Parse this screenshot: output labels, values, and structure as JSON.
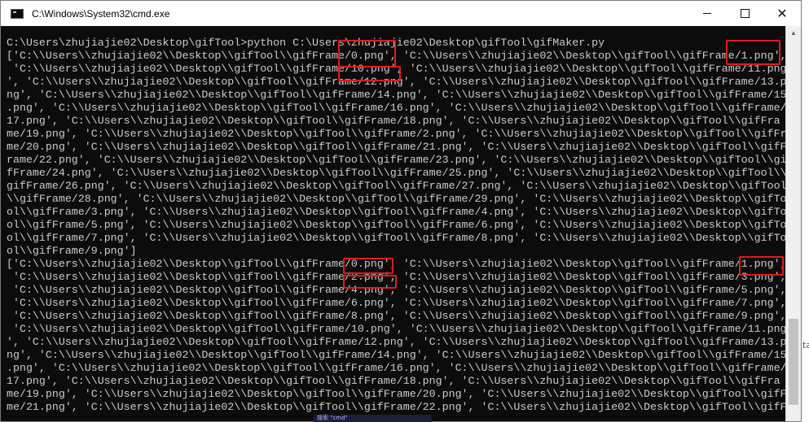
{
  "window": {
    "title": "C:\\Windows\\System32\\cmd.exe",
    "icon": "cmd-icon"
  },
  "console": {
    "lines": [
      "C:\\Users\\zhujiajie02\\Desktop\\gifTool>python C:\\Users\\zhujiajie02\\Desktop\\gifTool\\gifMaker.py",
      "['C:\\\\Users\\\\zhujiajie02\\\\Desktop\\\\gifTool\\\\gifFrame/0.png', 'C:\\\\Users\\\\zhujiajie02\\\\Desktop\\\\gifTool\\\\gifFrame/1.png',",
      " 'C:\\\\Users\\\\zhujiajie02\\\\Desktop\\\\gifTool\\\\gifFrame/10.png', 'C:\\\\Users\\\\zhujiajie02\\\\Desktop\\\\gifTool\\\\gifFrame/11.png",
      "', 'C:\\\\Users\\\\zhujiajie02\\\\Desktop\\\\gifTool\\\\gifFrame/12.png', 'C:\\\\Users\\\\zhujiajie02\\\\Desktop\\\\gifTool\\\\gifFrame/13.p",
      "ng', 'C:\\\\Users\\\\zhujiajie02\\\\Desktop\\\\gifTool\\\\gifFrame/14.png', 'C:\\\\Users\\\\zhujiajie02\\\\Desktop\\\\gifTool\\\\gifFrame/15",
      ".png', 'C:\\\\Users\\\\zhujiajie02\\\\Desktop\\\\gifTool\\\\gifFrame/16.png', 'C:\\\\Users\\\\zhujiajie02\\\\Desktop\\\\gifTool\\\\gifFrame/",
      "17.png', 'C:\\\\Users\\\\zhujiajie02\\\\Desktop\\\\gifTool\\\\gifFrame/18.png', 'C:\\\\Users\\\\zhujiajie02\\\\Desktop\\\\gifTool\\\\gifFra",
      "me/19.png', 'C:\\\\Users\\\\zhujiajie02\\\\Desktop\\\\gifTool\\\\gifFrame/2.png', 'C:\\\\Users\\\\zhujiajie02\\\\Desktop\\\\gifTool\\\\gifFra",
      "me/20.png', 'C:\\\\Users\\\\zhujiajie02\\\\Desktop\\\\gifTool\\\\gifFrame/21.png', 'C:\\\\Users\\\\zhujiajie02\\\\Desktop\\\\gifTool\\\\gifF",
      "rame/22.png', 'C:\\\\Users\\\\zhujiajie02\\\\Desktop\\\\gifTool\\\\gifFrame/23.png', 'C:\\\\Users\\\\zhujiajie02\\\\Desktop\\\\gifTool\\\\gi",
      "fFrame/24.png', 'C:\\\\Users\\\\zhujiajie02\\\\Desktop\\\\gifTool\\\\gifFrame/25.png', 'C:\\\\Users\\\\zhujiajie02\\\\Desktop\\\\gifTool\\\\",
      "gifFrame/26.png', 'C:\\\\Users\\\\zhujiajie02\\\\Desktop\\\\gifTool\\\\gifFrame/27.png', 'C:\\\\Users\\\\zhujiajie02\\\\Desktop\\\\gifTool",
      "\\\\gifFrame/28.png', 'C:\\\\Users\\\\zhujiajie02\\\\Desktop\\\\gifTool\\\\gifFrame/29.png', 'C:\\\\Users\\\\zhujiajie02\\\\Desktop\\\\gifTo",
      "ol\\\\gifFrame/3.png', 'C:\\\\Users\\\\zhujiajie02\\\\Desktop\\\\gifTool\\\\gifFrame/4.png', 'C:\\\\Users\\\\zhujiajie02\\\\Desktop\\\\gifTo",
      "ol\\\\gifFrame/5.png', 'C:\\\\Users\\\\zhujiajie02\\\\Desktop\\\\gifTool\\\\gifFrame/6.png', 'C:\\\\Users\\\\zhujiajie02\\\\Desktop\\\\gifTo",
      "ol\\\\gifFrame/7.png', 'C:\\\\Users\\\\zhujiajie02\\\\Desktop\\\\gifTool\\\\gifFrame/8.png', 'C:\\\\Users\\\\zhujiajie02\\\\Desktop\\\\gifTo",
      "ol\\\\gifFrame/9.png']",
      "['C:\\\\Users\\\\zhujiajie02\\\\Desktop\\\\gifTool\\\\gifFrame/0.png', 'C:\\\\Users\\\\zhujiajie02\\\\Desktop\\\\gifTool\\\\gifFrame/1.png',",
      " 'C:\\\\Users\\\\zhujiajie02\\\\Desktop\\\\gifTool\\\\gifFrame/2.png', 'C:\\\\Users\\\\zhujiajie02\\\\Desktop\\\\gifTool\\\\gifFrame/3.png',",
      " 'C:\\\\Users\\\\zhujiajie02\\\\Desktop\\\\gifTool\\\\gifFrame/4.png', 'C:\\\\Users\\\\zhujiajie02\\\\Desktop\\\\gifTool\\\\gifFrame/5.png',",
      " 'C:\\\\Users\\\\zhujiajie02\\\\Desktop\\\\gifTool\\\\gifFrame/6.png', 'C:\\\\Users\\\\zhujiajie02\\\\Desktop\\\\gifTool\\\\gifFrame/7.png',",
      " 'C:\\\\Users\\\\zhujiajie02\\\\Desktop\\\\gifTool\\\\gifFrame/8.png', 'C:\\\\Users\\\\zhujiajie02\\\\Desktop\\\\gifTool\\\\gifFrame/9.png',",
      " 'C:\\\\Users\\\\zhujiajie02\\\\Desktop\\\\gifTool\\\\gifFrame/10.png', 'C:\\\\Users\\\\zhujiajie02\\\\Desktop\\\\gifTool\\\\gifFrame/11.png",
      "', 'C:\\\\Users\\\\zhujiajie02\\\\Desktop\\\\gifTool\\\\gifFrame/12.png', 'C:\\\\Users\\\\zhujiajie02\\\\Desktop\\\\gifTool\\\\gifFrame/13.p",
      "ng', 'C:\\\\Users\\\\zhujiajie02\\\\Desktop\\\\gifTool\\\\gifFrame/14.png', 'C:\\\\Users\\\\zhujiajie02\\\\Desktop\\\\gifTool\\\\gifFrame/15",
      ".png', 'C:\\\\Users\\\\zhujiajie02\\\\Desktop\\\\gifTool\\\\gifFrame/16.png', 'C:\\\\Users\\\\zhujiajie02\\\\Desktop\\\\gifTool\\\\gifFrame/",
      "17.png', 'C:\\\\Users\\\\zhujiajie02\\\\Desktop\\\\gifTool\\\\gifFrame/18.png', 'C:\\\\Users\\\\zhujiajie02\\\\Desktop\\\\gifTool\\\\gifFra",
      "me/19.png', 'C:\\\\Users\\\\zhujiajie02\\\\Desktop\\\\gifTool\\\\gifFrame/20.png', 'C:\\\\Users\\\\zhujiajie02\\\\Desktop\\\\gifTool\\\\gifFra",
      "me/21.png', 'C:\\\\Users\\\\zhujiajie02\\\\Desktop\\\\gifTool\\\\gifFrame/22.png', 'C:\\\\Users\\\\zhujiajie02\\\\Desktop\\\\gifTool\\\\gifF"
    ]
  },
  "colors": {
    "console_bg": "#0c0c0c",
    "console_fg": "#cccccc",
    "annotation": "#e01b1b"
  },
  "background": {
    "side_glyph": "ta",
    "bottom_label": "搜索 \"cmd\""
  }
}
